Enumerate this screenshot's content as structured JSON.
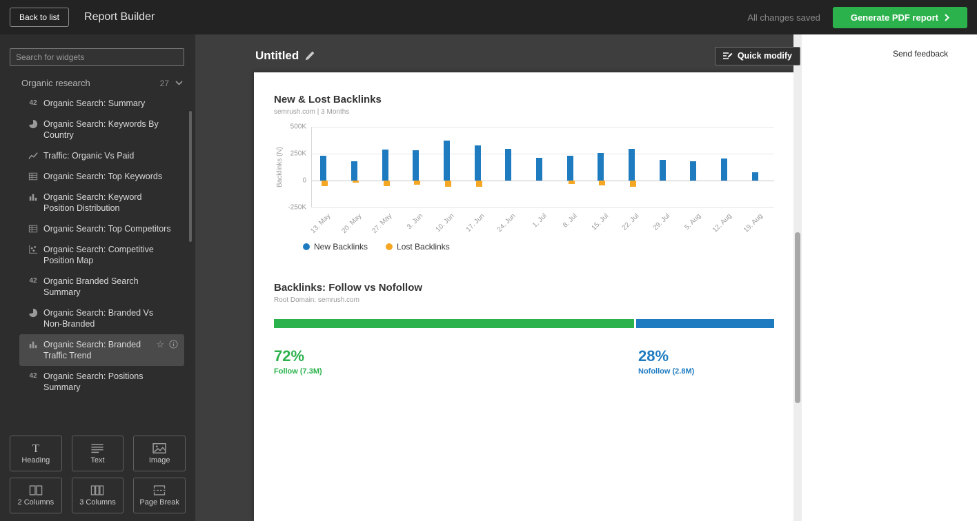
{
  "topbar": {
    "back_button": "Back to list",
    "title": "Report Builder",
    "saved_status": "All changes saved",
    "generate_button": "Generate PDF report"
  },
  "sidebar": {
    "search_placeholder": "Search for widgets",
    "section": {
      "label": "Organic research",
      "count": "27"
    },
    "items": [
      {
        "icon": "number-42-icon",
        "label": "Organic Search: Summary",
        "selected": false
      },
      {
        "icon": "pie-chart-icon",
        "label": "Organic Search: Keywords By Country",
        "selected": false
      },
      {
        "icon": "line-chart-icon",
        "label": "Traffic: Organic Vs Paid",
        "selected": false
      },
      {
        "icon": "table-icon",
        "label": "Organic Search: Top Keywords",
        "selected": false
      },
      {
        "icon": "bar-chart-icon",
        "label": "Organic Search: Keyword Position Distribution",
        "selected": false
      },
      {
        "icon": "table-icon",
        "label": "Organic Search: Top Competitors",
        "selected": false
      },
      {
        "icon": "scatter-plot-icon",
        "label": "Organic Search: Competitive Position Map",
        "selected": false
      },
      {
        "icon": "number-42-icon",
        "label": "Organic Branded Search Summary",
        "selected": false
      },
      {
        "icon": "pie-chart-icon",
        "label": "Organic Search: Branded Vs Non-Branded",
        "selected": false
      },
      {
        "icon": "bar-chart-icon",
        "label": "Organic Search: Branded Traffic Trend",
        "selected": true
      },
      {
        "icon": "number-42-icon",
        "label": "Organic Search: Positions Summary",
        "selected": false
      }
    ],
    "widget_buttons": [
      {
        "icon": "heading-icon",
        "label": "Heading"
      },
      {
        "icon": "text-icon",
        "label": "Text"
      },
      {
        "icon": "image-icon",
        "label": "Image"
      },
      {
        "icon": "two-columns-icon",
        "label": "2 Columns"
      },
      {
        "icon": "three-columns-icon",
        "label": "3 Columns"
      },
      {
        "icon": "page-break-icon",
        "label": "Page Break"
      }
    ]
  },
  "canvas": {
    "title": "Untitled",
    "quick_modify_label": "Quick modify",
    "send_feedback_label": "Send feedback"
  },
  "colors": {
    "green": "#2bb24c",
    "blue": "#1f7bc0",
    "orange": "#f5a623"
  },
  "chart_data": [
    {
      "type": "bar",
      "title": "New & Lost Backlinks",
      "subtitle": "semrush.com | 3 Months",
      "ylabel": "Backlinks (N)",
      "ylim": [
        -250000,
        500000
      ],
      "grid": true,
      "legend_position": "bottom-left",
      "yticks": [
        {
          "label": "500K",
          "value": 500000
        },
        {
          "label": "250K",
          "value": 250000
        },
        {
          "label": "0",
          "value": 0
        },
        {
          "label": "-250K",
          "value": -250000
        }
      ],
      "categories": [
        "13. May",
        "20. May",
        "27. May",
        "3. Jun",
        "10. Jun",
        "17. Jun",
        "24. Jun",
        "1. Jul",
        "8. Jul",
        "15. Jul",
        "22. Jul",
        "29. Jul",
        "5. Aug",
        "12. Aug",
        "19. Aug"
      ],
      "series": [
        {
          "name": "New Backlinks",
          "color": "#1f7bc0",
          "values": [
            230000,
            180000,
            290000,
            280000,
            370000,
            330000,
            295000,
            210000,
            230000,
            255000,
            295000,
            190000,
            180000,
            205000,
            75000
          ]
        },
        {
          "name": "Lost Backlinks",
          "color": "#f5a623",
          "values": [
            -50000,
            -20000,
            -50000,
            -40000,
            -55000,
            -55000,
            0,
            0,
            -30000,
            -45000,
            -55000,
            0,
            0,
            0,
            0
          ]
        }
      ]
    },
    {
      "type": "stacked-bar",
      "title": "Backlinks: Follow vs Nofollow",
      "subtitle": "Root Domain: semrush.com",
      "segments": [
        {
          "label": "Follow (7.3M)",
          "pct": "72%",
          "value": 72,
          "color": "#2bb24c"
        },
        {
          "label": "Nofollow (2.8M)",
          "pct": "28%",
          "value": 28,
          "color": "#1f7bc0"
        }
      ]
    }
  ]
}
